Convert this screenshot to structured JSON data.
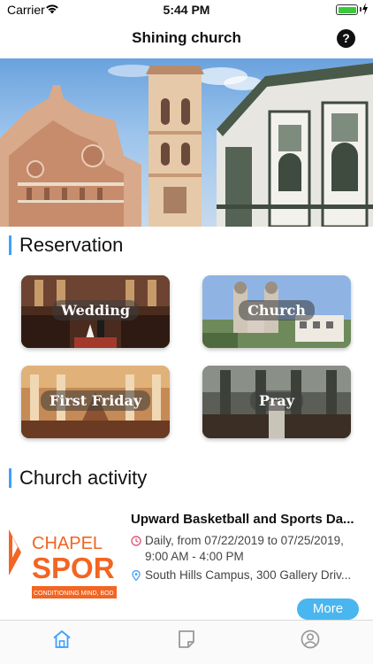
{
  "status_bar": {
    "carrier": "Carrier",
    "time": "5:44 PM",
    "battery_percent": 100,
    "icons": [
      "wifi-icon",
      "battery-icon",
      "charging-icon"
    ]
  },
  "nav": {
    "title": "Shining church",
    "help_icon": "?"
  },
  "hero": {
    "icon": "church-banner-image"
  },
  "reservation": {
    "title": "Reservation",
    "items": [
      {
        "label": "Wedding"
      },
      {
        "label": "Church"
      },
      {
        "label": "First Friday"
      },
      {
        "label": "Pray"
      }
    ]
  },
  "activity": {
    "title": "Church activity",
    "event": {
      "logo_text_top": "CHAPEL",
      "logo_text_main": "SPOR",
      "logo_tagline": "CONDITIONING MIND, BOD",
      "title": "Upward Basketball and Sports Da...",
      "time": "Daily, from 07/22/2019 to 07/25/2019, 9:00 AM - 4:00 PM",
      "location": "South Hills Campus, 300 Gallery Driv..."
    },
    "more_label": "More"
  },
  "tab_bar": {
    "tabs": [
      "home-icon",
      "notes-icon",
      "profile-icon"
    ],
    "active_tab": "home-icon"
  },
  "colors": {
    "accent": "#3ea0ff",
    "more_button": "#49b6f0",
    "tab_active": "#3ea0ff",
    "tab_inactive": "#999999",
    "time_icon": "#e35a7b",
    "location_icon": "#3ea0ff"
  }
}
